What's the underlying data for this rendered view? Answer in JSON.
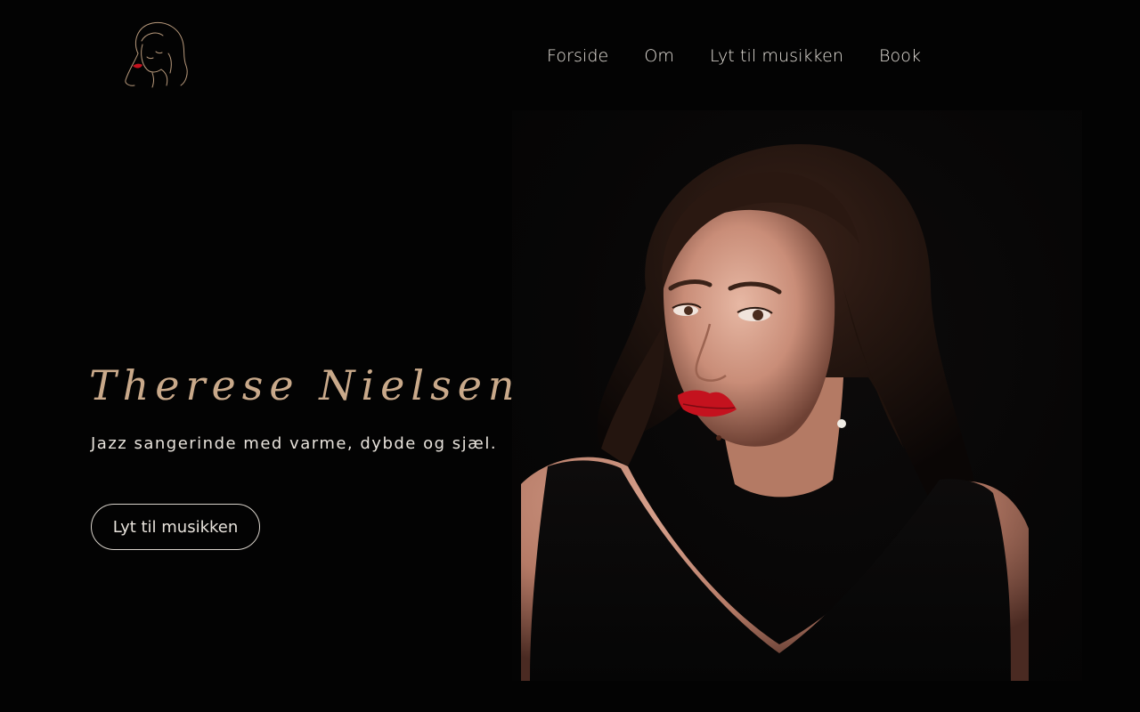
{
  "header": {
    "logo_icon": "woman-line-art-logo-icon",
    "nav": [
      {
        "label": "Forside"
      },
      {
        "label": "Om"
      },
      {
        "label": "Lyt til musikken"
      },
      {
        "label": "Book"
      }
    ]
  },
  "hero": {
    "name": "Therese Nielsen",
    "tagline": "Jazz sangerinde med varme, dybde og sjæl.",
    "cta_label": "Lyt til musikken",
    "portrait_image": "portrait-photo"
  },
  "colors": {
    "background": "#030303",
    "accent_gold": "#c9a98a",
    "text_light": "#e8e3dc",
    "lip_red": "#c4121e"
  }
}
